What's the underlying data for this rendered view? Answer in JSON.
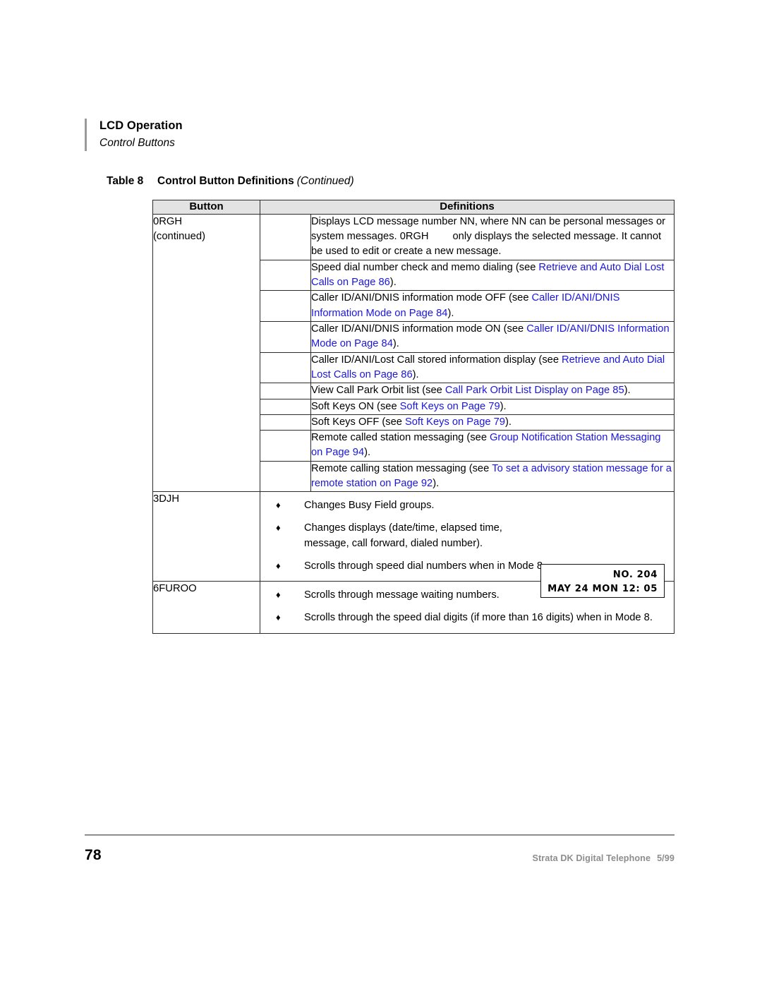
{
  "header": {
    "title": "LCD Operation",
    "subtitle": "Control Buttons"
  },
  "caption": {
    "label": "Table 8",
    "title": "Control Button Definitions",
    "continued": "(Continued)"
  },
  "table": {
    "columns": {
      "button": "Button",
      "definitions": "Definitions"
    },
    "groups": [
      {
        "button_name": "0RGH",
        "button_note": "(continued)",
        "rows": [
          {
            "type": "paragraph",
            "segments": [
              {
                "text": "Displays LCD message number NN, where NN can be personal messages or system messages. 0RGH",
                "link": false
              },
              {
                "text": "only displays the selected message. It cannot be used to edit or create a new message.",
                "link": false
              }
            ],
            "plain_prefix": "Displays LCD message number NN, where NN can be personal messages or system messages. 0RGH",
            "plain_suffix": "only displays the selected message. It cannot be used to edit or create a new message."
          },
          {
            "type": "xref",
            "lead": "Speed dial number check and memo dialing (see",
            "link": "Retrieve and Auto Dial Lost Calls",
            "link_tail": "on Page 86",
            "close": ")."
          },
          {
            "type": "xref",
            "lead": "Caller ID/ANI/DNIS information mode OFF (see",
            "link": "Caller ID/ANI/DNIS Information Mode",
            "link_tail": "on Page 84",
            "close": ")."
          },
          {
            "type": "xref",
            "lead": "Caller ID/ANI/DNIS information mode ON (see",
            "link": "Caller ID/ANI/DNIS Information Mode",
            "link_tail": "on Page 84",
            "close": ")."
          },
          {
            "type": "xref",
            "lead": "Caller ID/ANI/Lost Call stored information display (see",
            "link": "Retrieve and Auto Dial Lost Calls",
            "link_tail": "on Page 86",
            "close": ")."
          },
          {
            "type": "xref",
            "lead": "View Call Park Orbit list (see",
            "link": "Call Park Orbit List Display",
            "link_tail": "on Page 85",
            "close": ")."
          },
          {
            "type": "xref",
            "lead": "Soft Keys ON (see",
            "link": "Soft Keys",
            "link_tail": "on Page 79",
            "close": ")."
          },
          {
            "type": "xref",
            "lead": "Soft Keys OFF (see",
            "link": "Soft Keys",
            "link_tail": "on Page 79",
            "close": ")."
          },
          {
            "type": "xref",
            "lead": "Remote called station messaging (see",
            "link": "Group Notification Station Messaging",
            "link_tail": "on Page 94",
            "close": ")."
          },
          {
            "type": "xref",
            "lead": "Remote calling station messaging (see",
            "link": "To set a advisory station message for a remote station",
            "link_tail": "on Page 92",
            "close": ")."
          }
        ]
      },
      {
        "button_name": "3DJH",
        "button_note": "",
        "bullets": [
          "Changes Busy Field groups.",
          "Changes displays (date/time, elapsed time, message, call forward, dialed number).",
          "Scrolls through speed dial numbers when in Mode 8."
        ]
      },
      {
        "button_name": "6FUROO",
        "button_note": "",
        "bullets": [
          "Scrolls through message waiting numbers.",
          "Scrolls through the speed dial digits (if more than 16 digits) when in Mode 8."
        ]
      }
    ]
  },
  "lcd_display": {
    "line1": "NO. 204",
    "line2": "MAY 24 MON 12: 05"
  },
  "footer": {
    "page_number": "78",
    "document": "Strata DK Digital Telephone",
    "date": "5/99"
  },
  "bullet_glyph": "♦",
  "colors": {
    "xref_blue": "#1a16e0",
    "header_fill": "#e3e3e3",
    "rule_gray": "#8d8d8d"
  }
}
